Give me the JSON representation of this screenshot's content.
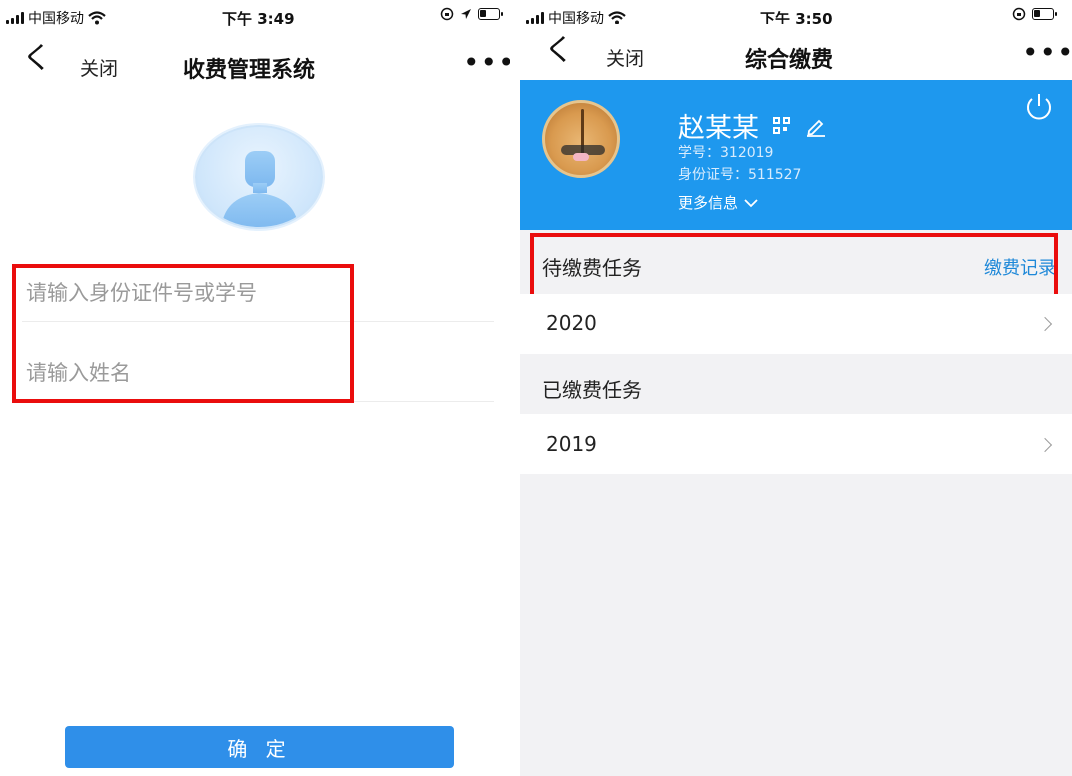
{
  "left_screen": {
    "status_bar": {
      "carrier": "中国移动",
      "time": "下午 3:49"
    },
    "nav": {
      "back_label": "く",
      "close_label": "关闭",
      "title": "收费管理系统",
      "more_label": "•••"
    },
    "form": {
      "id_placeholder": "请输入身份证件号或学号",
      "name_placeholder": "请输入姓名",
      "confirm_label": "确 定"
    }
  },
  "right_screen": {
    "status_bar": {
      "carrier": "中国移动",
      "time": "下午 3:50"
    },
    "nav": {
      "back_label": "く",
      "close_label": "关闭",
      "title": "综合缴费",
      "more_label": "•••"
    },
    "profile": {
      "name": "赵某某",
      "student_id": "学号：312019",
      "id_card": "身份证号：511527",
      "more_info_label": "更多信息"
    },
    "pending": {
      "label": "待缴费任务",
      "records_link": "缴费记录",
      "items": [
        {
          "label": "2020"
        }
      ]
    },
    "paid": {
      "label": "已缴费任务",
      "items": [
        {
          "label": "2019"
        }
      ]
    }
  },
  "colors": {
    "accent": "#1e98ee",
    "button": "#2f8fe9",
    "highlight": "#ea0d0d",
    "link": "#1e88d8"
  }
}
